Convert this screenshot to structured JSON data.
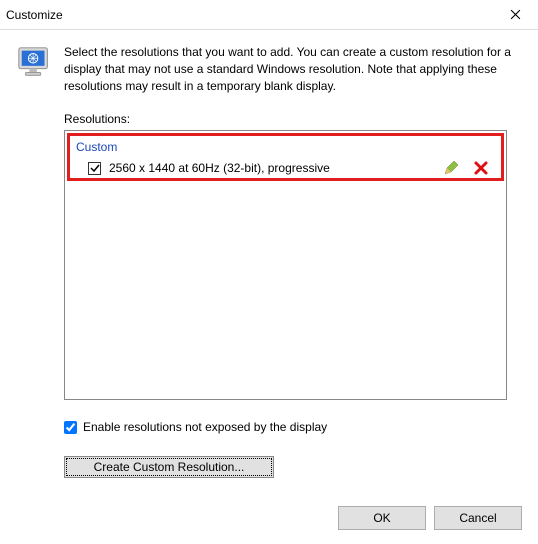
{
  "window": {
    "title": "Customize"
  },
  "intro": "Select the resolutions that you want to add. You can create a custom resolution for a display that may not use a standard Windows resolution. Note that applying these resolutions may result in a temporary blank display.",
  "resolutions_label": "Resolutions:",
  "group": {
    "header": "Custom",
    "item": "2560 x 1440 at 60Hz (32-bit), progressive"
  },
  "enable_label": "Enable resolutions not exposed by the display",
  "buttons": {
    "create": "Create Custom Resolution...",
    "ok": "OK",
    "cancel": "Cancel"
  }
}
